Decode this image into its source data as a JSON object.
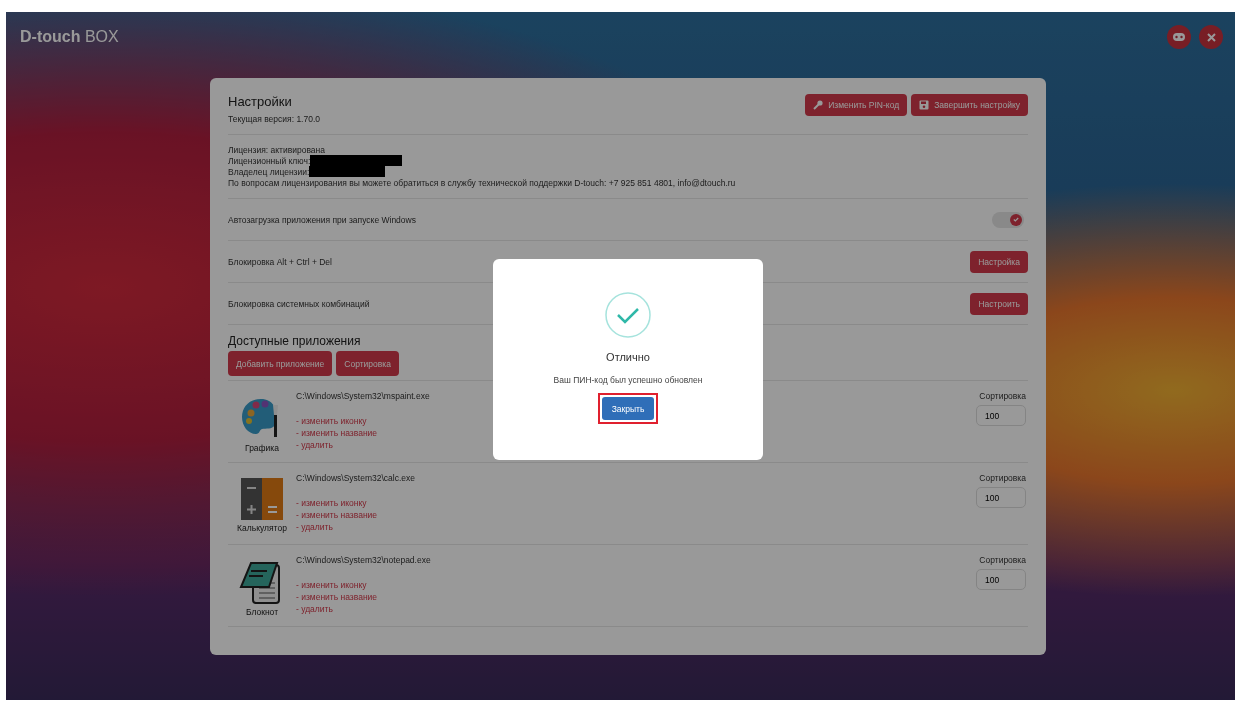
{
  "header": {
    "brand_bold": "D-touch",
    "brand_rest": "BOX"
  },
  "settings": {
    "title": "Настройки",
    "version": "Текущая версия: 1.70.0",
    "buttons": [
      {
        "label": "Изменить PIN-код"
      },
      {
        "label": "Завершить настройку"
      }
    ],
    "license": [
      {
        "text": "Лицензия: активирована",
        "redacted": false
      },
      {
        "text": "Лицензионный ключ:",
        "redacted": true
      },
      {
        "text": "Владелец лицензии:",
        "redacted": true
      },
      {
        "text": "По вопросам лицензирования вы можете обратиться в службу технической поддержки D-touch: +7 925 851 4801, info@dtouch.ru",
        "redacted": false
      }
    ],
    "options": [
      {
        "kind": "toggle",
        "label": "Автозагрузка приложения при запуске Windows",
        "on": true
      },
      {
        "kind": "button",
        "label": "Блокировка Alt + Ctrl + Del",
        "button": "Настройка"
      },
      {
        "kind": "button",
        "label": "Блокировка системных комбинаций",
        "button": "Настроить"
      }
    ],
    "apps_title": "Доступные приложения",
    "apps_buttons": [
      "Добавить приложение",
      "Сортировка"
    ],
    "apps": [
      {
        "name": "Графика",
        "path": "C:\\Windows\\System32\\mspaint.exe",
        "actions": [
          "- изменить иконку",
          "- изменить название",
          "- удалить"
        ],
        "sort_label": "Сортировка",
        "sort_value": "100"
      },
      {
        "name": "Калькулятор",
        "path": "C:\\Windows\\System32\\calc.exe",
        "actions": [
          "- изменить иконку",
          "- изменить название",
          "- удалить"
        ],
        "sort_label": "Сортировка",
        "sort_value": "100"
      },
      {
        "name": "Блокнот",
        "path": "C:\\Windows\\System32\\notepad.exe",
        "actions": [
          "- изменить иконку",
          "- изменить название",
          "- удалить"
        ],
        "sort_label": "Сортировка",
        "sort_value": "100"
      }
    ]
  },
  "dialog": {
    "title": "Отлично",
    "message": "Ваш ПИН-код был успешно обновлен",
    "button": "Закрыть",
    "highlighted": true
  }
}
